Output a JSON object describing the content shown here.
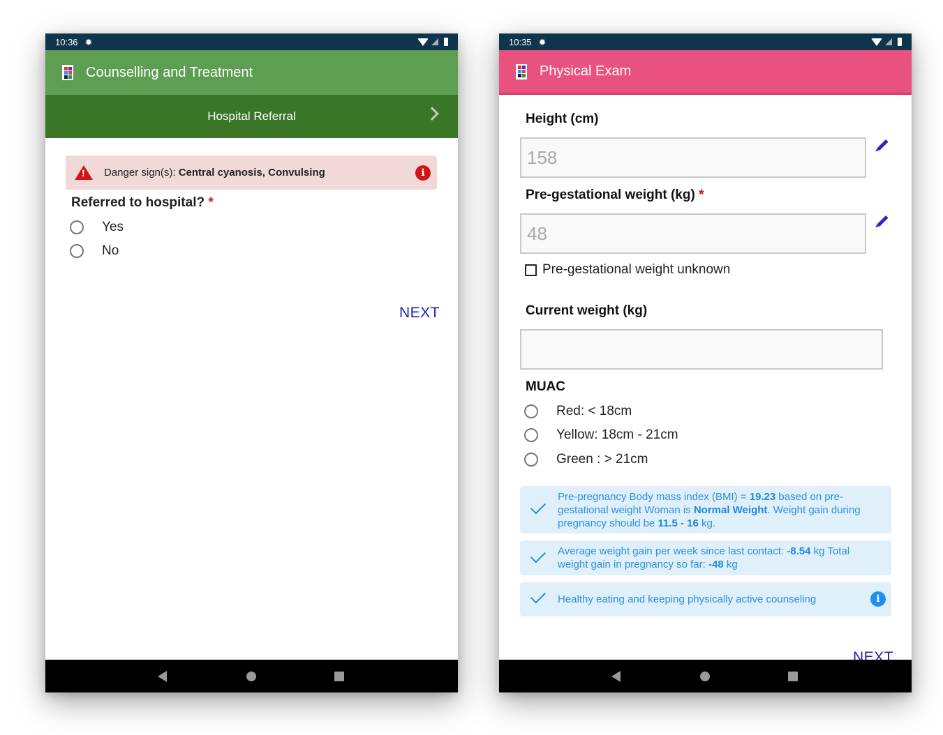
{
  "left_screen": {
    "status_bar": {
      "time": "10:36",
      "icons": [
        "settings-gear-icon",
        "wifi-icon",
        "signal-icon",
        "battery-icon"
      ]
    },
    "app_bar": {
      "title": "Counselling and Treatment",
      "color": "#5d9e52"
    },
    "sub_bar": {
      "title": "Hospital Referral",
      "color": "#3a7628",
      "icon": "chevron-right-icon"
    },
    "danger_alert": {
      "prefix": "Danger sign(s):",
      "signs": "Central cyanosis, Convulsing",
      "icon": "warning-triangle-icon",
      "info_icon": "info-icon",
      "background": "#f1d9da",
      "accent": "#d1141a"
    },
    "question": {
      "label": "Referred to hospital?",
      "required_marker": "*"
    },
    "options": [
      {
        "label": "Yes",
        "selected": false
      },
      {
        "label": "No",
        "selected": false
      }
    ],
    "next_label": "NEXT",
    "nav": {
      "back": "back-icon",
      "home": "home-icon",
      "recents": "recents-icon"
    }
  },
  "right_screen": {
    "status_bar": {
      "time": "10:35",
      "icons": [
        "settings-gear-icon",
        "wifi-icon",
        "signal-icon",
        "battery-icon"
      ]
    },
    "app_bar": {
      "title": "Physical Exam",
      "color": "#e9527e"
    },
    "height": {
      "label": "Height (cm)",
      "value": "158"
    },
    "pregestational_weight": {
      "label": "Pre-gestational weight (kg)",
      "required_marker": "*",
      "value": "48"
    },
    "weight_unknown": {
      "label": "Pre-gestational weight unknown",
      "checked": false
    },
    "current_weight": {
      "label": "Current weight (kg)",
      "value": ""
    },
    "muac": {
      "label": "MUAC",
      "options": [
        {
          "label": "Red: < 18cm",
          "selected": false
        },
        {
          "label": "Yellow: 18cm - 21cm",
          "selected": false
        },
        {
          "label": "Green : > 21cm",
          "selected": false
        }
      ]
    },
    "notices": {
      "bmi": {
        "t1": "Pre-pregnancy Body mass index (BMI) = ",
        "bmi": "19.23",
        "t2": " based on pre-gestational weight Woman is ",
        "category": "Normal Weight",
        "t3": ". Weight gain during pregnancy should be ",
        "range": "11.5 - 16",
        "t4": " kg."
      },
      "gain": {
        "t1": "Average weight gain per week since last contact: ",
        "avg": "-8.54",
        "t2": " kg Total weight gain in pregnancy so far: ",
        "total": "-48",
        "t3": " kg"
      },
      "counseling": {
        "text": "Healthy eating and keeping physically active counseling"
      }
    },
    "next_label": "NEXT",
    "nav": {
      "back": "back-icon",
      "home": "home-icon",
      "recents": "recents-icon"
    }
  }
}
